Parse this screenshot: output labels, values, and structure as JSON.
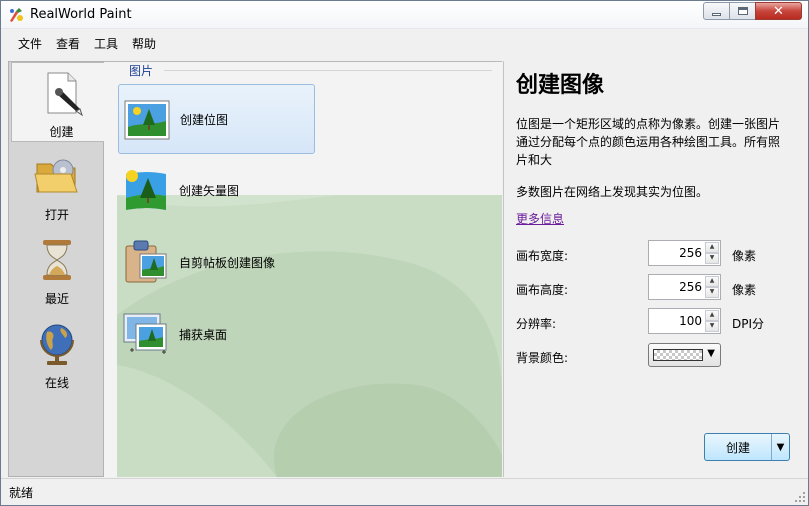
{
  "window": {
    "title": "RealWorld Paint"
  },
  "menu": [
    "文件",
    "查看",
    "工具",
    "帮助"
  ],
  "nav": [
    {
      "label": "创建",
      "icon": "new-document-icon",
      "selected": true
    },
    {
      "label": "打开",
      "icon": "folder-open-icon",
      "selected": false
    },
    {
      "label": "最近",
      "icon": "hourglass-icon",
      "selected": false
    },
    {
      "label": "在线",
      "icon": "globe-icon",
      "selected": false
    }
  ],
  "group_title": "图片",
  "actions": [
    {
      "label": "创建位图",
      "icon": "bitmap-picture-icon",
      "selected": true
    },
    {
      "label": "创建矢量图",
      "icon": "vector-picture-icon",
      "selected": false
    },
    {
      "label": "自剪帖板创建图像",
      "icon": "clipboard-picture-icon",
      "selected": false
    },
    {
      "label": "捕获桌面",
      "icon": "screen-capture-icon",
      "selected": false
    }
  ],
  "details": {
    "title": "创建图像",
    "description": "位图是一个矩形区域的点称为像素。创建一张图片通过分配每个点的颜色运用各种绘图工具。所有照片和大",
    "note": "多数图片在网络上发现其实为位图。",
    "more_link": "更多信息",
    "width": {
      "label": "画布宽度:",
      "value": "256",
      "unit": "像素"
    },
    "height": {
      "label": "画布高度:",
      "value": "256",
      "unit": "像素"
    },
    "resolution": {
      "label": "分辨率:",
      "value": "100",
      "unit": "DPI分"
    },
    "background": {
      "label": "背景颜色:"
    },
    "create_button": "创建"
  },
  "status": "就绪",
  "colors": {
    "accent_link": "#6c1d9c",
    "group_title": "#1c3f94",
    "panel_green": "#c9dcc4"
  }
}
